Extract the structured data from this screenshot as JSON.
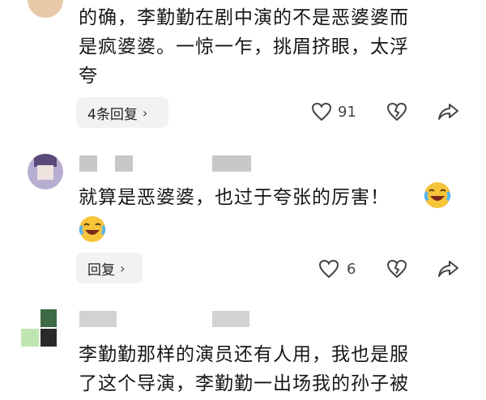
{
  "comments": [
    {
      "text_lines": [
        "的确，李勤勤在剧中演的不是恶婆婆而",
        "是疯婆婆。一惊一乍，挑眉挤眼，太浮",
        "夸"
      ],
      "reply_button": "4条回复",
      "like_count": "91"
    },
    {
      "text_line_1": "就算是恶婆婆，也过于夸张的厉害！",
      "reply_button": "回复",
      "like_count": "6"
    },
    {
      "text_lines": [
        "李勤勤那样的演员还有人用，我也是服",
        "了这个导演，李勤勤一出场我的孙子被"
      ]
    }
  ],
  "icons": {
    "like": "heart-outline-icon",
    "dislike": "broken-heart-icon",
    "share": "share-arrow-icon",
    "emoji": "crying-laughing-emoji-icon",
    "chevron": "chevron-right-icon"
  },
  "colors": {
    "text": "#161616",
    "pill_bg": "#f2f2f2",
    "icon": "#444444"
  }
}
